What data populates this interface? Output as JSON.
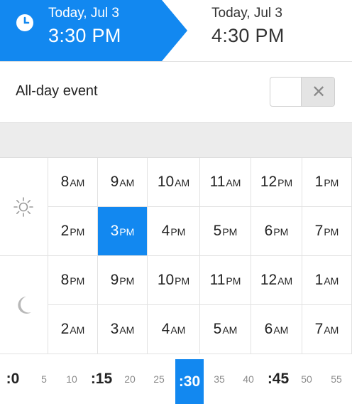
{
  "header": {
    "start_date": "Today, Jul 3",
    "start_time": "3:30 PM",
    "end_date": "Today, Jul 3",
    "end_time": "4:30 PM",
    "start_icon": "clock-icon"
  },
  "all_day": {
    "label": "All-day event",
    "enabled": false,
    "toggle_icon": "x-icon"
  },
  "hours": {
    "day_icon": "sun-icon",
    "night_icon": "moon-icon",
    "selected": "3PM",
    "rows": [
      [
        {
          "n": "8",
          "ap": "AM"
        },
        {
          "n": "9",
          "ap": "AM"
        },
        {
          "n": "10",
          "ap": "AM"
        },
        {
          "n": "11",
          "ap": "AM"
        },
        {
          "n": "12",
          "ap": "PM"
        },
        {
          "n": "1",
          "ap": "PM"
        }
      ],
      [
        {
          "n": "2",
          "ap": "PM"
        },
        {
          "n": "3",
          "ap": "PM"
        },
        {
          "n": "4",
          "ap": "PM"
        },
        {
          "n": "5",
          "ap": "PM"
        },
        {
          "n": "6",
          "ap": "PM"
        },
        {
          "n": "7",
          "ap": "PM"
        }
      ],
      [
        {
          "n": "8",
          "ap": "PM"
        },
        {
          "n": "9",
          "ap": "PM"
        },
        {
          "n": "10",
          "ap": "PM"
        },
        {
          "n": "11",
          "ap": "PM"
        },
        {
          "n": "12",
          "ap": "AM"
        },
        {
          "n": "1",
          "ap": "AM"
        }
      ],
      [
        {
          "n": "2",
          "ap": "AM"
        },
        {
          "n": "3",
          "ap": "AM"
        },
        {
          "n": "4",
          "ap": "AM"
        },
        {
          "n": "5",
          "ap": "AM"
        },
        {
          "n": "6",
          "ap": "AM"
        },
        {
          "n": "7",
          "ap": "AM"
        }
      ]
    ]
  },
  "minutes": {
    "selected": ":30",
    "items": [
      {
        "label": ":0",
        "major": true
      },
      {
        "label": "5",
        "major": false
      },
      {
        "label": "10",
        "major": false
      },
      {
        "label": ":15",
        "major": true
      },
      {
        "label": "20",
        "major": false
      },
      {
        "label": "25",
        "major": false
      },
      {
        "label": ":30",
        "major": true
      },
      {
        "label": "35",
        "major": false
      },
      {
        "label": "40",
        "major": false
      },
      {
        "label": ":45",
        "major": true
      },
      {
        "label": "50",
        "major": false
      },
      {
        "label": "55",
        "major": false
      }
    ]
  },
  "colors": {
    "accent": "#1288f0",
    "grid_line": "#e2e2e2",
    "band": "#ececec"
  }
}
